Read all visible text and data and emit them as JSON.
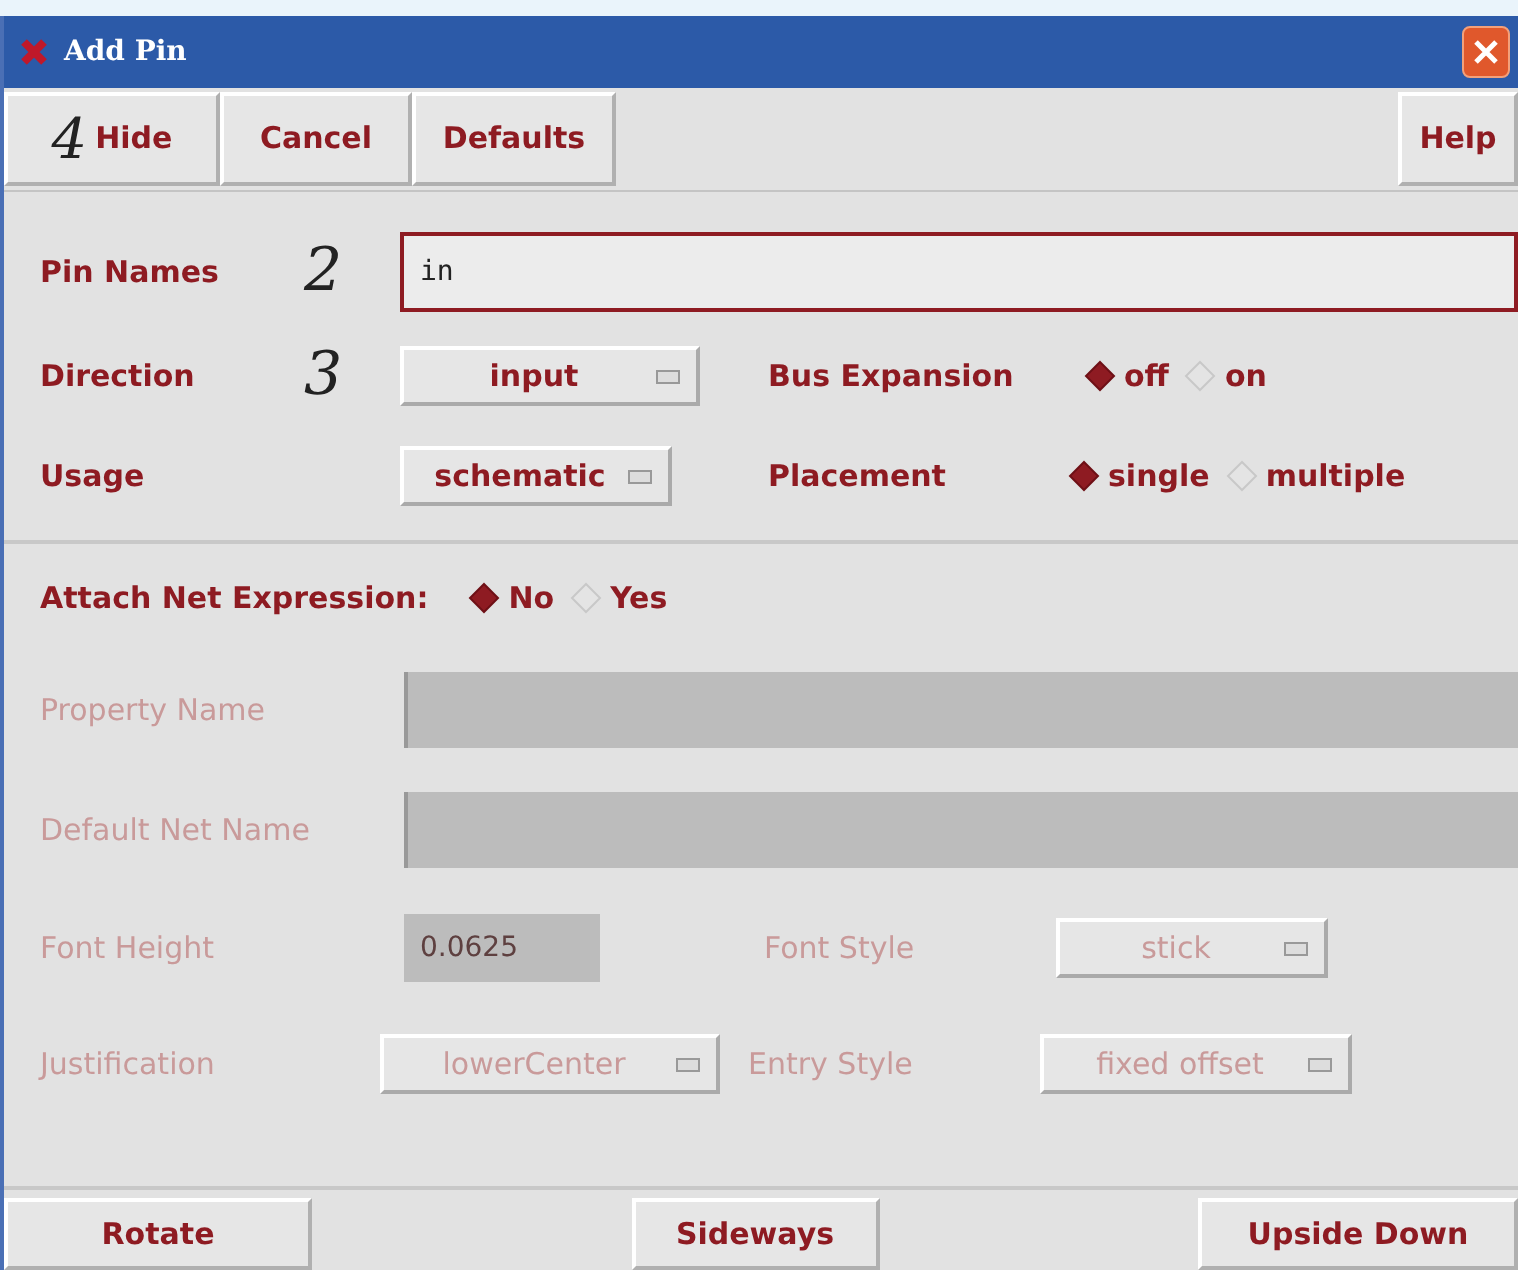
{
  "window": {
    "title": "Add Pin"
  },
  "toolbar": [
    {
      "label": "Hide",
      "marker": "4"
    },
    {
      "label": "Cancel"
    },
    {
      "label": "Defaults"
    },
    {
      "label": "Help"
    }
  ],
  "pin_names": {
    "label": "Pin Names",
    "marker": "2",
    "value": "in"
  },
  "direction": {
    "label": "Direction",
    "marker": "3",
    "value": "input"
  },
  "bus_expansion": {
    "label": "Bus Expansion",
    "options": [
      {
        "label": "off",
        "selected": true
      },
      {
        "label": "on",
        "selected": false
      }
    ]
  },
  "usage": {
    "label": "Usage",
    "value": "schematic"
  },
  "placement": {
    "label": "Placement",
    "options": [
      {
        "label": "single",
        "selected": true
      },
      {
        "label": "multiple",
        "selected": false
      }
    ]
  },
  "attach_net_expression": {
    "label": "Attach Net Expression:",
    "options": [
      {
        "label": "No",
        "selected": true
      },
      {
        "label": "Yes",
        "selected": false
      }
    ]
  },
  "property_name": {
    "label": "Property Name",
    "disabled": true
  },
  "default_net_name": {
    "label": "Default Net Name",
    "disabled": true
  },
  "font_height": {
    "label": "Font Height",
    "value": "0.0625",
    "disabled": true
  },
  "font_style": {
    "label": "Font Style",
    "value": "stick",
    "disabled": true
  },
  "justification": {
    "label": "Justification",
    "value": "lowerCenter",
    "disabled": true
  },
  "entry_style": {
    "label": "Entry Style",
    "value": "fixed offset",
    "disabled": true
  },
  "bottom_buttons": [
    {
      "label": "Rotate"
    },
    {
      "label": "Sideways"
    },
    {
      "label": "Upside Down"
    }
  ]
}
